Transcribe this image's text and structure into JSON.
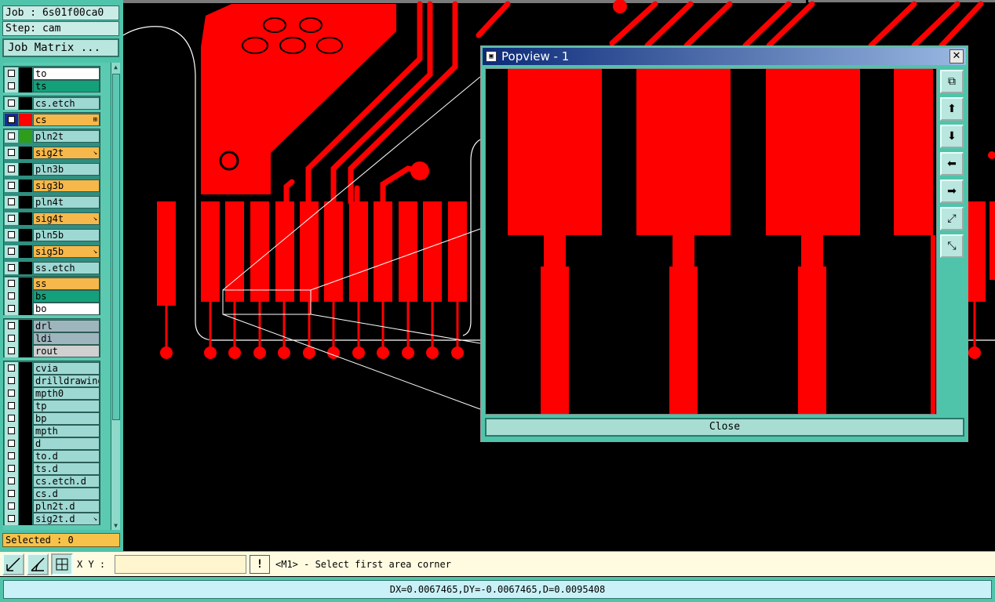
{
  "job": {
    "job_line": "Job : 6s01f00ca0",
    "step_line": "Step: cam",
    "matrix_button": "Job Matrix ..."
  },
  "layers": [
    {
      "name": "to",
      "color": "#ffffff",
      "mark": ""
    },
    {
      "name": "ts",
      "color": "#14a07a",
      "mark": ""
    },
    {
      "name": "cs.etch",
      "color": "#9ed8d3",
      "mark": ""
    },
    {
      "name": "cs",
      "color": "#f6b84a",
      "mark": "⊞",
      "active": true
    },
    {
      "name": "pln2t",
      "color": "#9ed8d3",
      "mark": ""
    },
    {
      "name": "sig2t",
      "color": "#f6b84a",
      "mark": "↘"
    },
    {
      "name": "pln3b",
      "color": "#9ed8d3",
      "mark": ""
    },
    {
      "name": "sig3b",
      "color": "#f6b84a",
      "mark": ""
    },
    {
      "name": "pln4t",
      "color": "#9ed8d3",
      "mark": ""
    },
    {
      "name": "sig4t",
      "color": "#f6b84a",
      "mark": "↘"
    },
    {
      "name": "pln5b",
      "color": "#9ed8d3",
      "mark": ""
    },
    {
      "name": "sig5b",
      "color": "#f6b84a",
      "mark": "↘"
    },
    {
      "name": "ss.etch",
      "color": "#9ed8d3",
      "mark": ""
    },
    {
      "name": "ss",
      "color": "#f6b84a",
      "mark": ""
    },
    {
      "name": "bs",
      "color": "#14a07a",
      "mark": ""
    },
    {
      "name": "bo",
      "color": "#ffffff",
      "mark": ""
    },
    {
      "name": "drl",
      "color": "#9fb5be",
      "mark": ""
    },
    {
      "name": "ldi",
      "color": "#9fb5be",
      "mark": ""
    },
    {
      "name": "rout",
      "color": "#d0d0d0",
      "mark": ""
    },
    {
      "name": "cvia",
      "color": "#9ed8d3",
      "mark": ""
    },
    {
      "name": "drilldrawing",
      "color": "#9ed8d3",
      "mark": ""
    },
    {
      "name": "mpth0",
      "color": "#9ed8d3",
      "mark": ""
    },
    {
      "name": "tp",
      "color": "#9ed8d3",
      "mark": ""
    },
    {
      "name": "bp",
      "color": "#9ed8d3",
      "mark": ""
    },
    {
      "name": "mpth",
      "color": "#9ed8d3",
      "mark": ""
    },
    {
      "name": "d",
      "color": "#9ed8d3",
      "mark": ""
    },
    {
      "name": "to.d",
      "color": "#9ed8d3",
      "mark": ""
    },
    {
      "name": "ts.d",
      "color": "#9ed8d3",
      "mark": ""
    },
    {
      "name": "cs.etch.d",
      "color": "#9ed8d3",
      "mark": ""
    },
    {
      "name": "cs.d",
      "color": "#9ed8d3",
      "mark": ""
    },
    {
      "name": "pln2t.d",
      "color": "#9ed8d3",
      "mark": ""
    },
    {
      "name": "sig2t.d",
      "color": "#9ed8d3",
      "mark": "↘"
    }
  ],
  "selected": "Selected : 0",
  "popview": {
    "title": "Popview - 1",
    "close_label": "Close",
    "close_x": "✕"
  },
  "bottom": {
    "xy_label": "X Y :",
    "xy_value": "",
    "exclaim": "!",
    "prompt": "<M1> - Select first area corner"
  },
  "status": {
    "text": "DX=0.0067465,DY=-0.0067465,D=0.0095408"
  },
  "colors": {
    "copper": "#ff0000",
    "panel": "#4fc4aa",
    "outline": "#ffffff"
  }
}
